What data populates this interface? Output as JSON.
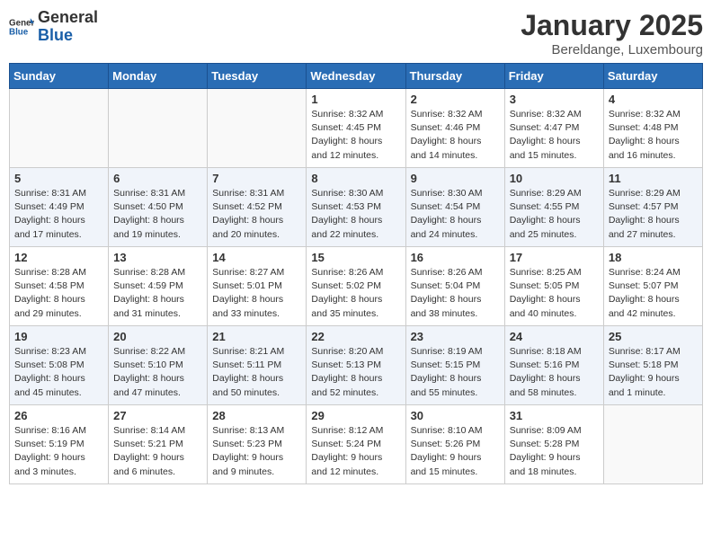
{
  "header": {
    "logo_general": "General",
    "logo_blue": "Blue",
    "month_title": "January 2025",
    "subtitle": "Bereldange, Luxembourg"
  },
  "weekdays": [
    "Sunday",
    "Monday",
    "Tuesday",
    "Wednesday",
    "Thursday",
    "Friday",
    "Saturday"
  ],
  "rows": [
    {
      "cells": [
        {
          "day": "",
          "empty": true
        },
        {
          "day": "",
          "empty": true
        },
        {
          "day": "",
          "empty": true
        },
        {
          "day": "1",
          "sunrise": "Sunrise: 8:32 AM",
          "sunset": "Sunset: 4:45 PM",
          "daylight": "Daylight: 8 hours and 12 minutes."
        },
        {
          "day": "2",
          "sunrise": "Sunrise: 8:32 AM",
          "sunset": "Sunset: 4:46 PM",
          "daylight": "Daylight: 8 hours and 14 minutes."
        },
        {
          "day": "3",
          "sunrise": "Sunrise: 8:32 AM",
          "sunset": "Sunset: 4:47 PM",
          "daylight": "Daylight: 8 hours and 15 minutes."
        },
        {
          "day": "4",
          "sunrise": "Sunrise: 8:32 AM",
          "sunset": "Sunset: 4:48 PM",
          "daylight": "Daylight: 8 hours and 16 minutes."
        }
      ]
    },
    {
      "cells": [
        {
          "day": "5",
          "sunrise": "Sunrise: 8:31 AM",
          "sunset": "Sunset: 4:49 PM",
          "daylight": "Daylight: 8 hours and 17 minutes."
        },
        {
          "day": "6",
          "sunrise": "Sunrise: 8:31 AM",
          "sunset": "Sunset: 4:50 PM",
          "daylight": "Daylight: 8 hours and 19 minutes."
        },
        {
          "day": "7",
          "sunrise": "Sunrise: 8:31 AM",
          "sunset": "Sunset: 4:52 PM",
          "daylight": "Daylight: 8 hours and 20 minutes."
        },
        {
          "day": "8",
          "sunrise": "Sunrise: 8:30 AM",
          "sunset": "Sunset: 4:53 PM",
          "daylight": "Daylight: 8 hours and 22 minutes."
        },
        {
          "day": "9",
          "sunrise": "Sunrise: 8:30 AM",
          "sunset": "Sunset: 4:54 PM",
          "daylight": "Daylight: 8 hours and 24 minutes."
        },
        {
          "day": "10",
          "sunrise": "Sunrise: 8:29 AM",
          "sunset": "Sunset: 4:55 PM",
          "daylight": "Daylight: 8 hours and 25 minutes."
        },
        {
          "day": "11",
          "sunrise": "Sunrise: 8:29 AM",
          "sunset": "Sunset: 4:57 PM",
          "daylight": "Daylight: 8 hours and 27 minutes."
        }
      ]
    },
    {
      "cells": [
        {
          "day": "12",
          "sunrise": "Sunrise: 8:28 AM",
          "sunset": "Sunset: 4:58 PM",
          "daylight": "Daylight: 8 hours and 29 minutes."
        },
        {
          "day": "13",
          "sunrise": "Sunrise: 8:28 AM",
          "sunset": "Sunset: 4:59 PM",
          "daylight": "Daylight: 8 hours and 31 minutes."
        },
        {
          "day": "14",
          "sunrise": "Sunrise: 8:27 AM",
          "sunset": "Sunset: 5:01 PM",
          "daylight": "Daylight: 8 hours and 33 minutes."
        },
        {
          "day": "15",
          "sunrise": "Sunrise: 8:26 AM",
          "sunset": "Sunset: 5:02 PM",
          "daylight": "Daylight: 8 hours and 35 minutes."
        },
        {
          "day": "16",
          "sunrise": "Sunrise: 8:26 AM",
          "sunset": "Sunset: 5:04 PM",
          "daylight": "Daylight: 8 hours and 38 minutes."
        },
        {
          "day": "17",
          "sunrise": "Sunrise: 8:25 AM",
          "sunset": "Sunset: 5:05 PM",
          "daylight": "Daylight: 8 hours and 40 minutes."
        },
        {
          "day": "18",
          "sunrise": "Sunrise: 8:24 AM",
          "sunset": "Sunset: 5:07 PM",
          "daylight": "Daylight: 8 hours and 42 minutes."
        }
      ]
    },
    {
      "cells": [
        {
          "day": "19",
          "sunrise": "Sunrise: 8:23 AM",
          "sunset": "Sunset: 5:08 PM",
          "daylight": "Daylight: 8 hours and 45 minutes."
        },
        {
          "day": "20",
          "sunrise": "Sunrise: 8:22 AM",
          "sunset": "Sunset: 5:10 PM",
          "daylight": "Daylight: 8 hours and 47 minutes."
        },
        {
          "day": "21",
          "sunrise": "Sunrise: 8:21 AM",
          "sunset": "Sunset: 5:11 PM",
          "daylight": "Daylight: 8 hours and 50 minutes."
        },
        {
          "day": "22",
          "sunrise": "Sunrise: 8:20 AM",
          "sunset": "Sunset: 5:13 PM",
          "daylight": "Daylight: 8 hours and 52 minutes."
        },
        {
          "day": "23",
          "sunrise": "Sunrise: 8:19 AM",
          "sunset": "Sunset: 5:15 PM",
          "daylight": "Daylight: 8 hours and 55 minutes."
        },
        {
          "day": "24",
          "sunrise": "Sunrise: 8:18 AM",
          "sunset": "Sunset: 5:16 PM",
          "daylight": "Daylight: 8 hours and 58 minutes."
        },
        {
          "day": "25",
          "sunrise": "Sunrise: 8:17 AM",
          "sunset": "Sunset: 5:18 PM",
          "daylight": "Daylight: 9 hours and 1 minute."
        }
      ]
    },
    {
      "cells": [
        {
          "day": "26",
          "sunrise": "Sunrise: 8:16 AM",
          "sunset": "Sunset: 5:19 PM",
          "daylight": "Daylight: 9 hours and 3 minutes."
        },
        {
          "day": "27",
          "sunrise": "Sunrise: 8:14 AM",
          "sunset": "Sunset: 5:21 PM",
          "daylight": "Daylight: 9 hours and 6 minutes."
        },
        {
          "day": "28",
          "sunrise": "Sunrise: 8:13 AM",
          "sunset": "Sunset: 5:23 PM",
          "daylight": "Daylight: 9 hours and 9 minutes."
        },
        {
          "day": "29",
          "sunrise": "Sunrise: 8:12 AM",
          "sunset": "Sunset: 5:24 PM",
          "daylight": "Daylight: 9 hours and 12 minutes."
        },
        {
          "day": "30",
          "sunrise": "Sunrise: 8:10 AM",
          "sunset": "Sunset: 5:26 PM",
          "daylight": "Daylight: 9 hours and 15 minutes."
        },
        {
          "day": "31",
          "sunrise": "Sunrise: 8:09 AM",
          "sunset": "Sunset: 5:28 PM",
          "daylight": "Daylight: 9 hours and 18 minutes."
        },
        {
          "day": "",
          "empty": true
        }
      ]
    }
  ]
}
